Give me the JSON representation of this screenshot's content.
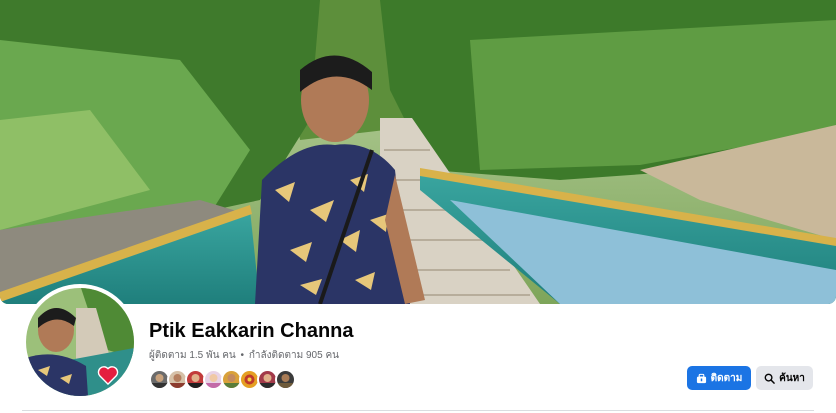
{
  "profile": {
    "name": "Ptik Eakkarin Channa",
    "followers_text": "ผู้ติดตาม 1.5 พัน คน",
    "separator": "•",
    "following_text": "กำลังติดตาม 905 คน"
  },
  "friends": {
    "avatars": [
      "friend-1",
      "friend-2",
      "friend-3",
      "friend-4",
      "friend-5",
      "friend-6",
      "friend-7",
      "friend-8"
    ]
  },
  "actions": {
    "follow_label": "ติดตาม",
    "search_label": "ค้นหา"
  },
  "colors": {
    "primary": "#1b74e4",
    "secondary_bg": "#e4e6eb",
    "heart": "#e41e3f"
  }
}
